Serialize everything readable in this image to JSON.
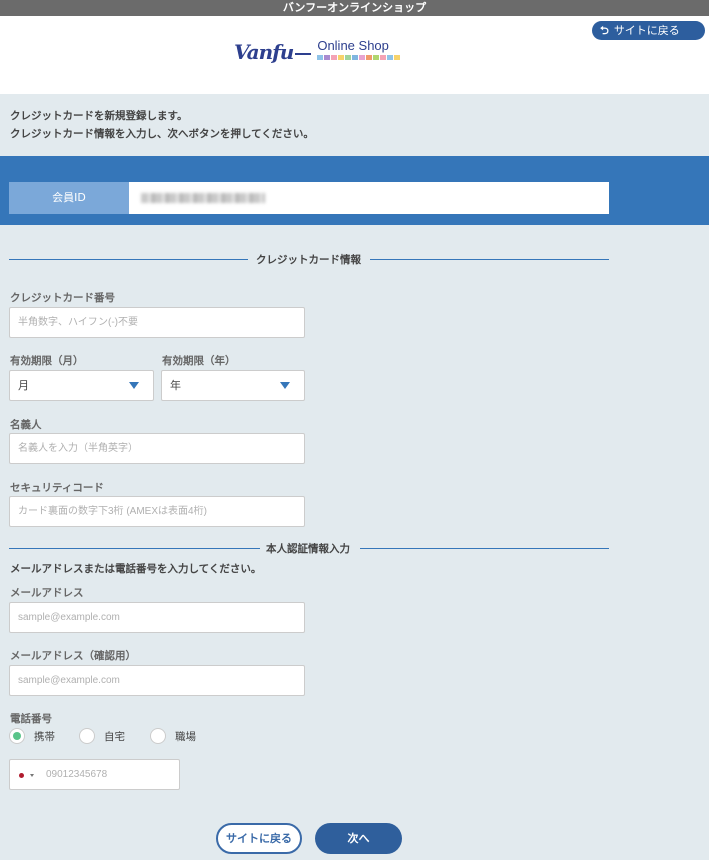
{
  "app": {
    "title": "バンフーオンラインショップ"
  },
  "header": {
    "back_to_site": "サイトに戻る",
    "logo_mark": "Vanfu",
    "logo_text": "Online Shop",
    "logo_stripe_colors": [
      "#8fc3e8",
      "#a98bd0",
      "#f4a3b5",
      "#f7d36b",
      "#9fd49c",
      "#7fb6e0",
      "#e8a3d0",
      "#f19a6b",
      "#b0d66f",
      "#f4a3b5",
      "#8fc3e8",
      "#f7d36b"
    ]
  },
  "intro": {
    "line1": "クレジットカードを新規登録します。",
    "line2": "クレジットカード情報を入力し、次へボタンを押してください。"
  },
  "member": {
    "label": "会員ID"
  },
  "card_section": {
    "title": "クレジットカード情報",
    "card_number_label": "クレジットカード番号",
    "card_number_placeholder": "半角数字、ハイフン(-)不要",
    "exp_month_label": "有効期限（月）",
    "exp_month_value": "月",
    "exp_year_label": "有効期限（年）",
    "exp_year_value": "年",
    "holder_label": "名義人",
    "holder_placeholder": "名義人を入力（半角英字）",
    "security_label": "セキュリティコード",
    "security_placeholder": "カード裏面の数字下3桁 (AMEXは表面4桁)"
  },
  "auth_section": {
    "title": "本人認証情報入力",
    "note": "メールアドレスまたは電話番号を入力してください。",
    "email_label": "メールアドレス",
    "email_placeholder": "sample@example.com",
    "email_confirm_label": "メールアドレス（確認用）",
    "email_confirm_placeholder": "sample@example.com",
    "phone_label": "電話番号",
    "phone_types": [
      {
        "label": "携帯",
        "selected": true
      },
      {
        "label": "自宅",
        "selected": false
      },
      {
        "label": "職場",
        "selected": false
      }
    ],
    "phone_placeholder": "09012345678"
  },
  "footer": {
    "back_button": "サイトに戻る",
    "next_button": "次へ"
  },
  "colors": {
    "accent": "#3576b9",
    "button": "#2f5f9c",
    "background": "#e2eaee",
    "radio_on": "#5ac48a"
  }
}
